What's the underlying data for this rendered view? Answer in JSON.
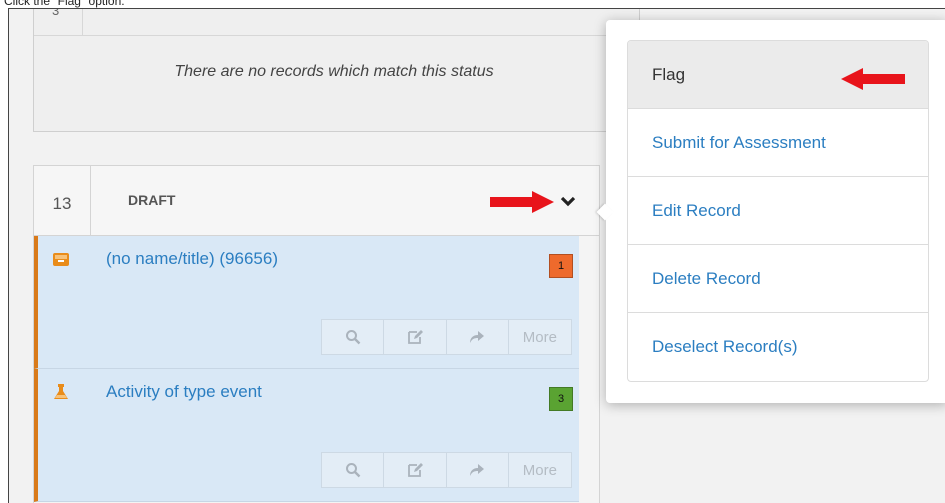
{
  "caption": "Click the \"Flag\" option.",
  "empty_status": {
    "message": "There are no records which match this status"
  },
  "draft_section": {
    "count": "13",
    "title": "DRAFT"
  },
  "records": [
    {
      "title": "(no name/title) (96656)",
      "badge": "1",
      "badge_color": "#ee6a2c",
      "icon": "inbox-tray-icon",
      "actions": {
        "more_label": "More"
      }
    },
    {
      "title": "Activity of type event",
      "badge": "3",
      "badge_color": "#5aa332",
      "icon": "flask-icon",
      "actions": {
        "more_label": "More"
      }
    }
  ],
  "dropdown_menu": {
    "items": [
      {
        "label": "Flag"
      },
      {
        "label": "Submit for Assessment"
      },
      {
        "label": "Edit Record"
      },
      {
        "label": "Delete Record"
      },
      {
        "label": "Deselect Record(s)"
      }
    ]
  },
  "colors": {
    "link_blue": "#2b7ec1",
    "accent_orange": "#d97a1a",
    "annotation_red": "#e8141b",
    "record_bg": "#d9e8f6"
  }
}
